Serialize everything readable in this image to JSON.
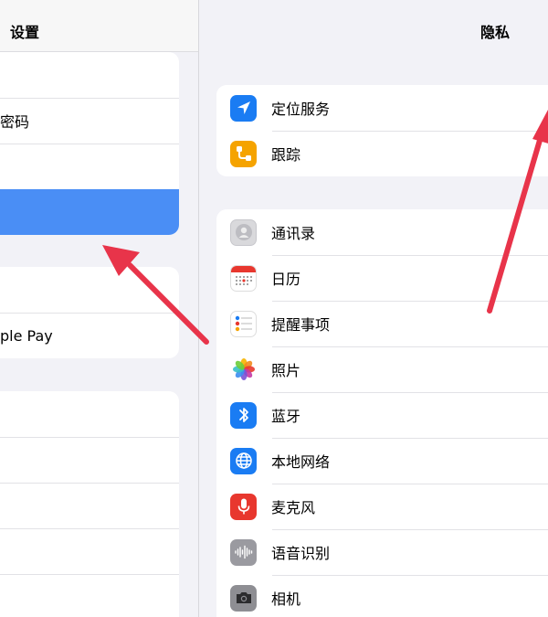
{
  "left": {
    "title": "设置",
    "items": [
      {
        "label": ""
      },
      {
        "label": "密码"
      },
      {
        "label": ""
      },
      {
        "label": ""
      },
      {
        "label": ""
      },
      {
        "label": "ple Pay"
      },
      {
        "label": ""
      },
      {
        "label": ""
      },
      {
        "label": ""
      },
      {
        "label": ""
      },
      {
        "label": ""
      }
    ]
  },
  "right": {
    "title": "隐私",
    "group1": [
      {
        "label": "定位服务",
        "icon": "location-arrow-icon"
      },
      {
        "label": "跟踪",
        "icon": "tracking-icon"
      }
    ],
    "group2": [
      {
        "label": "通讯录",
        "icon": "contacts-icon"
      },
      {
        "label": "日历",
        "icon": "calendar-icon"
      },
      {
        "label": "提醒事项",
        "icon": "reminders-icon"
      },
      {
        "label": "照片",
        "icon": "photos-icon"
      },
      {
        "label": "蓝牙",
        "icon": "bluetooth-icon"
      },
      {
        "label": "本地网络",
        "icon": "globe-icon"
      },
      {
        "label": "麦克风",
        "icon": "microphone-icon"
      },
      {
        "label": "语音识别",
        "icon": "waveform-icon"
      },
      {
        "label": "相机",
        "icon": "camera-icon"
      }
    ]
  },
  "colors": {
    "accent_selected": "#4a8ef5",
    "annotation_arrow": "#e8344a",
    "location_blue": "#1a7cf3",
    "tracking_orange": "#f5a300",
    "bluetooth_blue": "#1a7cf3",
    "globe_blue": "#1a7cf3",
    "microphone_red": "#e8372e"
  }
}
